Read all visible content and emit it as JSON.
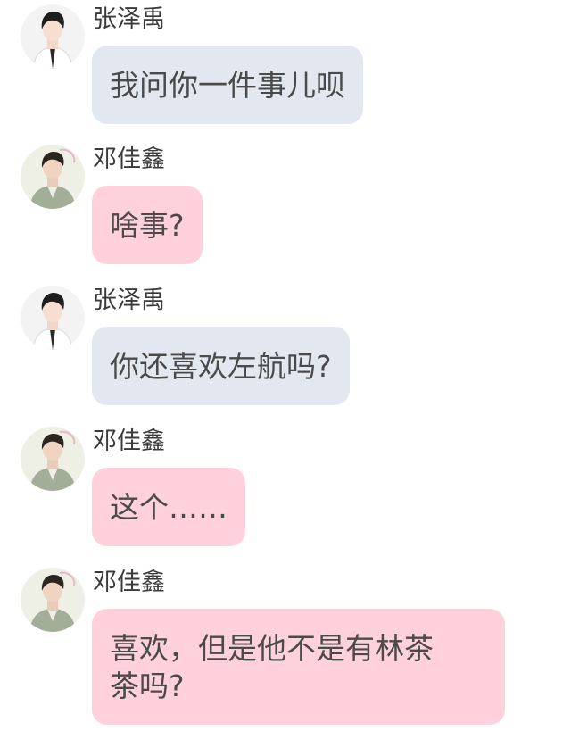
{
  "messages": [
    {
      "sender": "张泽禹",
      "text": "我问你一件事儿呗",
      "avatar_icon": "user-avatar-zhang-icon"
    },
    {
      "sender": "邓佳鑫",
      "text": "啥事?",
      "avatar_icon": "user-avatar-deng-icon"
    },
    {
      "sender": "张泽禹",
      "text": "你还喜欢左航吗?",
      "avatar_icon": "user-avatar-zhang-icon"
    },
    {
      "sender": "邓佳鑫",
      "text": "这个……",
      "avatar_icon": "user-avatar-deng-icon"
    },
    {
      "sender": "邓佳鑫",
      "text": "喜欢，但是他不是有林茶\n茶吗?",
      "avatar_icon": "user-avatar-deng-icon"
    }
  ],
  "colors": {
    "bubble_sender_a": "#e3e8f0",
    "bubble_sender_b": "#ffd1dc",
    "text": "#4a4a4a",
    "name": "#3a3a3a"
  }
}
